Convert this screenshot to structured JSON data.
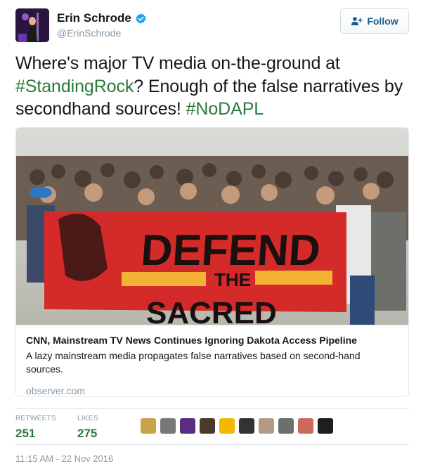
{
  "author": {
    "name": "Erin Schrode",
    "handle": "@ErinSchrode",
    "verified": true
  },
  "follow_button": {
    "label": "Follow",
    "icon": "add-user-icon"
  },
  "tweet": {
    "text_part1": "Where's major TV media on-the-ground at ",
    "hashtag1": "#StandingRock",
    "text_part2": "? Enough of the false narratives by secondhand sources! ",
    "hashtag2": "#NoDAPL"
  },
  "card": {
    "banner_text_1": "DEFEND",
    "banner_text_2": "THE",
    "banner_text_3": "SACRED",
    "title": "CNN, Mainstream TV News Continues Ignoring Dakota Access Pipeline",
    "description": "A lazy mainstream media propagates false narratives based on second-hand sources.",
    "domain": "observer.com"
  },
  "stats": {
    "retweets_label": "RETWEETS",
    "retweets_value": "251",
    "likes_label": "LIKES",
    "likes_value": "275"
  },
  "likers": [
    {
      "color": "#c9a24a"
    },
    {
      "color": "#777777"
    },
    {
      "color": "#5a2d82"
    },
    {
      "color": "#4a3a2e"
    },
    {
      "color": "#f5b800"
    },
    {
      "color": "#333333"
    },
    {
      "color": "#b39a84"
    },
    {
      "color": "#6d6f6a"
    },
    {
      "color": "#cc6a5a"
    },
    {
      "color": "#1e1e1e"
    }
  ],
  "timestamp": "11:15 AM - 22 Nov 2016",
  "colors": {
    "hashtag": "#2b7a3d",
    "follow_text": "#1b5c89",
    "muted": "#8899a6",
    "banner_red": "#d42a2a",
    "banner_yellow": "#f2b233"
  }
}
